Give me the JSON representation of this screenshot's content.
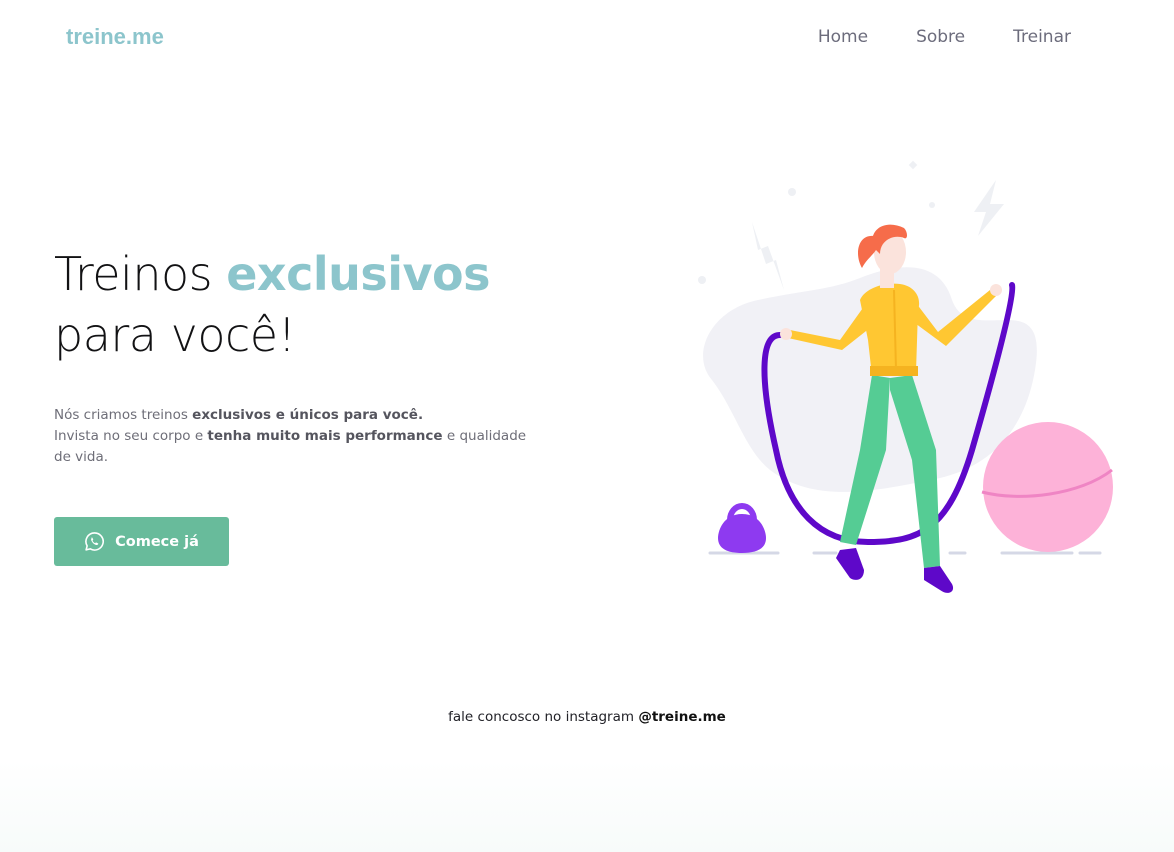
{
  "header": {
    "brand": "treine.me",
    "nav": [
      {
        "label": "Home"
      },
      {
        "label": "Sobre"
      },
      {
        "label": "Treinar"
      }
    ]
  },
  "hero": {
    "title_prefix": "Treinos ",
    "title_accent": "exclusivos",
    "title_suffix": "para você!",
    "line1_plain": "Nós criamos treinos ",
    "line1_bold": "exclusivos e únicos para você.",
    "line2_plain": "Invista no seu corpo e ",
    "line2_bold": "tenha muito mais performance",
    "line2_end": " e qualidade de vida.",
    "cta_label": "Comece já",
    "cta_icon": "whatsapp-icon"
  },
  "illustration": {
    "name": "woman-jumping-rope-illustration",
    "colors": {
      "hoodie": "#ffc732",
      "pants": "#55cc94",
      "rope": "#5e08c9",
      "kettlebell": "#8e3af0",
      "ball": "#fdb2d8",
      "hair": "#f66c4a",
      "blob": "#f1f1f6"
    }
  },
  "footer": {
    "prefix": "fale concosco no instagram ",
    "handle": "@treine.me"
  },
  "colors": {
    "accent": "#8cc5cc",
    "button": "#68bb9b",
    "text": "#121214"
  }
}
